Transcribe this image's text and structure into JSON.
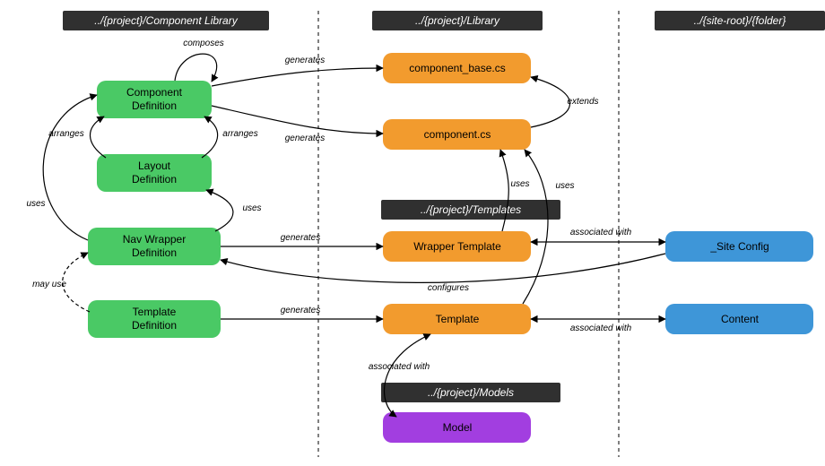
{
  "columns": {
    "left": {
      "header": "../{project}/Component Library"
    },
    "middle": {
      "header": "../{project}/Library",
      "sub_templates": "../{project}/Templates",
      "sub_models": "../{project}/Models"
    },
    "right": {
      "header": "../{site-root}/{folder}"
    }
  },
  "nodes": {
    "component_def": {
      "label1": "Component",
      "label2": "Definition"
    },
    "layout_def": {
      "label1": "Layout",
      "label2": "Definition"
    },
    "nav_wrapper_def": {
      "label1": "Nav Wrapper",
      "label2": "Definition"
    },
    "template_def": {
      "label1": "Template",
      "label2": "Definition"
    },
    "component_base": {
      "label": "component_base.cs"
    },
    "component_cs": {
      "label": "component.cs"
    },
    "wrapper_tpl": {
      "label": "Wrapper Template"
    },
    "template": {
      "label": "Template"
    },
    "model": {
      "label": "Model"
    },
    "site_config": {
      "label": "_Site Config"
    },
    "content": {
      "label": "Content"
    }
  },
  "edges": {
    "composes": "composes",
    "generates": "generates",
    "extends": "extends",
    "arranges": "arranges",
    "uses": "uses",
    "may_use": "may use",
    "associated_with": "associated with",
    "configures": "configures"
  }
}
